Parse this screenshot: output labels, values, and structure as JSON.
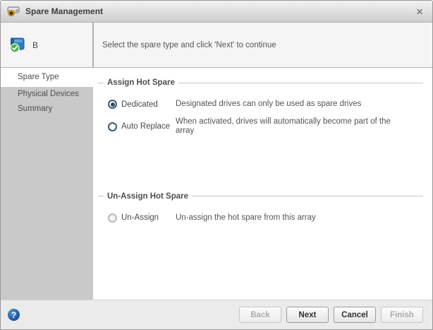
{
  "window": {
    "title": "Spare Management",
    "close_glyph": "×"
  },
  "header": {
    "array_label": "B",
    "instruction": "Select the spare type and click 'Next' to continue"
  },
  "sidebar": {
    "steps": [
      {
        "label": "Spare Type",
        "active": true
      },
      {
        "label": "Physical Devices",
        "active": false
      },
      {
        "label": "Summary",
        "active": false
      }
    ]
  },
  "sections": [
    {
      "title": "Assign Hot Spare",
      "options": [
        {
          "label": "Dedicated",
          "selected": true,
          "disabled": false,
          "description": "Designated drives can only be used as spare drives"
        },
        {
          "label": "Auto Replace",
          "selected": false,
          "disabled": false,
          "description": "When activated, drives will automatically become part of the array"
        }
      ]
    },
    {
      "title": "Un-Assign Hot Spare",
      "options": [
        {
          "label": "Un-Assign",
          "selected": false,
          "disabled": true,
          "description": "Un-assign the hot spare from this array"
        }
      ]
    }
  ],
  "footer": {
    "help_glyph": "?",
    "buttons": [
      {
        "label": "Back",
        "enabled": false
      },
      {
        "label": "Next",
        "enabled": true
      },
      {
        "label": "Cancel",
        "enabled": true
      },
      {
        "label": "Finish",
        "enabled": false
      }
    ]
  },
  "colors": {
    "radio_accent": "#3b5a6d",
    "sidebar_gray": "#c9c9c9",
    "help_blue": "#1a4f96",
    "array_icon_blue": "#2e7cc0",
    "check_green": "#44b049",
    "badge_orange": "#f0a31c"
  }
}
